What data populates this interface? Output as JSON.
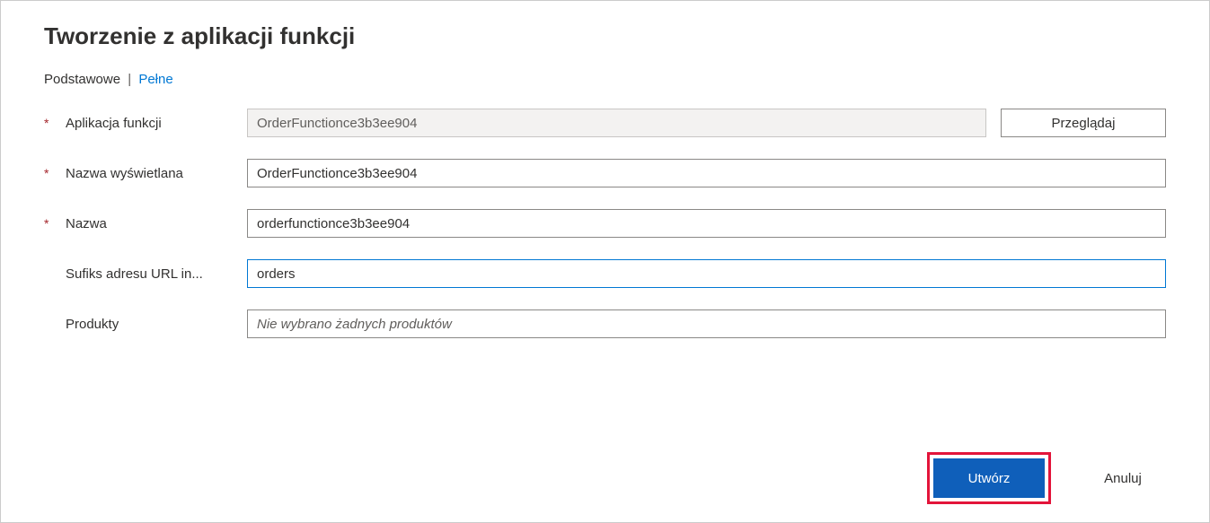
{
  "header": {
    "title": "Tworzenie z aplikacji funkcji"
  },
  "tabs": {
    "basic": "Podstawowe",
    "separator": "|",
    "full": "Pełne"
  },
  "form": {
    "function_app": {
      "label": "Aplikacja funkcji",
      "value": "OrderFunctionce3b3ee904",
      "browse": "Przeglądaj"
    },
    "display_name": {
      "label": "Nazwa wyświetlana",
      "value": "OrderFunctionce3b3ee904"
    },
    "name": {
      "label": "Nazwa",
      "value": "orderfunctionce3b3ee904"
    },
    "url_suffix": {
      "label": "Sufiks adresu URL in...",
      "value": "orders"
    },
    "products": {
      "label": "Produkty",
      "placeholder": "Nie wybrano żadnych produktów"
    }
  },
  "footer": {
    "create": "Utwórz",
    "cancel": "Anuluj"
  }
}
